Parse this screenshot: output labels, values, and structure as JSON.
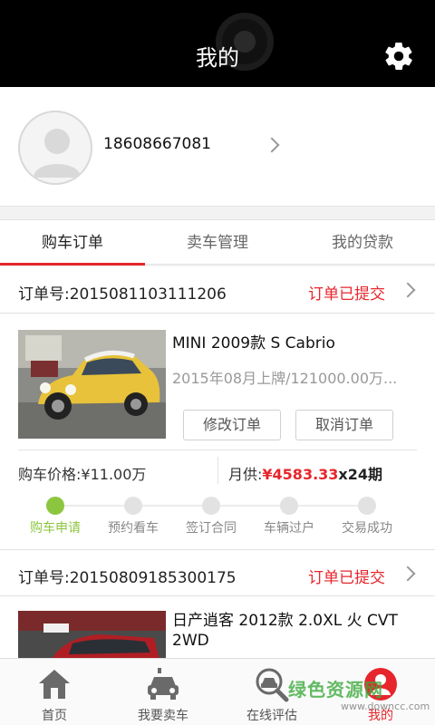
{
  "header": {
    "title": "我的",
    "settings_icon": "gear-icon"
  },
  "profile": {
    "phone": "18608667081",
    "avatar_icon": "user-avatar-icon"
  },
  "tabs": [
    {
      "label": "购车订单",
      "active": true
    },
    {
      "label": "卖车管理",
      "active": false
    },
    {
      "label": "我的贷款",
      "active": false
    }
  ],
  "orders": [
    {
      "order_label": "订单号:",
      "order_no": "2015081103111206",
      "status": "订单已提交",
      "car_title": "MINI  2009款 S Cabrio",
      "car_sub": "2015年08月上牌/121000.00万...",
      "modify_label": "修改订单",
      "cancel_label": "取消订单",
      "price_label": "购车价格:",
      "price_value": "¥11.00万",
      "monthly_label": "月供:",
      "monthly_amount": "¥4583.33",
      "monthly_term": "x24期",
      "steps": [
        {
          "label": "购车申请",
          "done": true
        },
        {
          "label": "预约看车",
          "done": false
        },
        {
          "label": "签订合同",
          "done": false
        },
        {
          "label": "车辆过户",
          "done": false
        },
        {
          "label": "交易成功",
          "done": false
        }
      ]
    },
    {
      "order_label": "订单号:",
      "order_no": "2015080918530017",
      "order_no_suffix": "5",
      "status": "订单已提交",
      "car_title": "日产逍客  2012款 2.0XL 火 CVT 2WD"
    }
  ],
  "bottom_nav": [
    {
      "label": "首页",
      "icon": "home-icon",
      "active": false
    },
    {
      "label": "我要卖车",
      "icon": "car-icon",
      "active": false
    },
    {
      "label": "在线评估",
      "icon": "car-search-icon",
      "active": false
    },
    {
      "label": "我的",
      "icon": "user-icon",
      "active": true
    }
  ],
  "watermark": {
    "main": "绿色资源网",
    "url": "www.downcc.com"
  },
  "colors": {
    "accent": "#e6262c",
    "progress_done": "#8cc63f",
    "topbar": "#000000"
  }
}
